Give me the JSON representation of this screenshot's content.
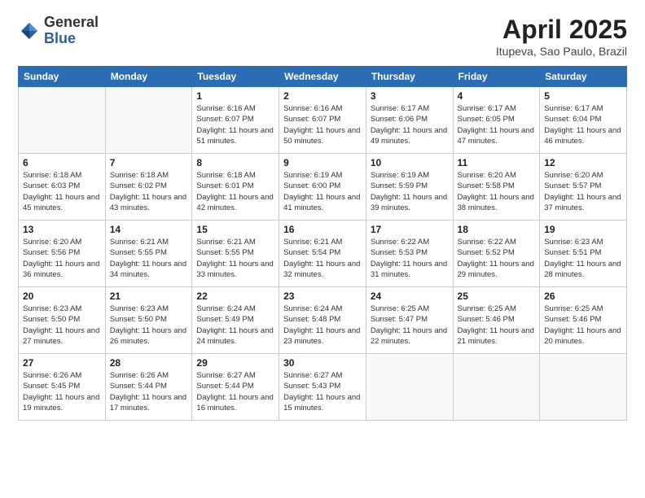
{
  "header": {
    "logo_general": "General",
    "logo_blue": "Blue",
    "title": "April 2025",
    "subtitle": "Itupeva, Sao Paulo, Brazil"
  },
  "days_of_week": [
    "Sunday",
    "Monday",
    "Tuesday",
    "Wednesday",
    "Thursday",
    "Friday",
    "Saturday"
  ],
  "weeks": [
    [
      {
        "day": "",
        "info": ""
      },
      {
        "day": "",
        "info": ""
      },
      {
        "day": "1",
        "info": "Sunrise: 6:16 AM\nSunset: 6:07 PM\nDaylight: 11 hours and 51 minutes."
      },
      {
        "day": "2",
        "info": "Sunrise: 6:16 AM\nSunset: 6:07 PM\nDaylight: 11 hours and 50 minutes."
      },
      {
        "day": "3",
        "info": "Sunrise: 6:17 AM\nSunset: 6:06 PM\nDaylight: 11 hours and 49 minutes."
      },
      {
        "day": "4",
        "info": "Sunrise: 6:17 AM\nSunset: 6:05 PM\nDaylight: 11 hours and 47 minutes."
      },
      {
        "day": "5",
        "info": "Sunrise: 6:17 AM\nSunset: 6:04 PM\nDaylight: 11 hours and 46 minutes."
      }
    ],
    [
      {
        "day": "6",
        "info": "Sunrise: 6:18 AM\nSunset: 6:03 PM\nDaylight: 11 hours and 45 minutes."
      },
      {
        "day": "7",
        "info": "Sunrise: 6:18 AM\nSunset: 6:02 PM\nDaylight: 11 hours and 43 minutes."
      },
      {
        "day": "8",
        "info": "Sunrise: 6:18 AM\nSunset: 6:01 PM\nDaylight: 11 hours and 42 minutes."
      },
      {
        "day": "9",
        "info": "Sunrise: 6:19 AM\nSunset: 6:00 PM\nDaylight: 11 hours and 41 minutes."
      },
      {
        "day": "10",
        "info": "Sunrise: 6:19 AM\nSunset: 5:59 PM\nDaylight: 11 hours and 39 minutes."
      },
      {
        "day": "11",
        "info": "Sunrise: 6:20 AM\nSunset: 5:58 PM\nDaylight: 11 hours and 38 minutes."
      },
      {
        "day": "12",
        "info": "Sunrise: 6:20 AM\nSunset: 5:57 PM\nDaylight: 11 hours and 37 minutes."
      }
    ],
    [
      {
        "day": "13",
        "info": "Sunrise: 6:20 AM\nSunset: 5:56 PM\nDaylight: 11 hours and 36 minutes."
      },
      {
        "day": "14",
        "info": "Sunrise: 6:21 AM\nSunset: 5:55 PM\nDaylight: 11 hours and 34 minutes."
      },
      {
        "day": "15",
        "info": "Sunrise: 6:21 AM\nSunset: 5:55 PM\nDaylight: 11 hours and 33 minutes."
      },
      {
        "day": "16",
        "info": "Sunrise: 6:21 AM\nSunset: 5:54 PM\nDaylight: 11 hours and 32 minutes."
      },
      {
        "day": "17",
        "info": "Sunrise: 6:22 AM\nSunset: 5:53 PM\nDaylight: 11 hours and 31 minutes."
      },
      {
        "day": "18",
        "info": "Sunrise: 6:22 AM\nSunset: 5:52 PM\nDaylight: 11 hours and 29 minutes."
      },
      {
        "day": "19",
        "info": "Sunrise: 6:23 AM\nSunset: 5:51 PM\nDaylight: 11 hours and 28 minutes."
      }
    ],
    [
      {
        "day": "20",
        "info": "Sunrise: 6:23 AM\nSunset: 5:50 PM\nDaylight: 11 hours and 27 minutes."
      },
      {
        "day": "21",
        "info": "Sunrise: 6:23 AM\nSunset: 5:50 PM\nDaylight: 11 hours and 26 minutes."
      },
      {
        "day": "22",
        "info": "Sunrise: 6:24 AM\nSunset: 5:49 PM\nDaylight: 11 hours and 24 minutes."
      },
      {
        "day": "23",
        "info": "Sunrise: 6:24 AM\nSunset: 5:48 PM\nDaylight: 11 hours and 23 minutes."
      },
      {
        "day": "24",
        "info": "Sunrise: 6:25 AM\nSunset: 5:47 PM\nDaylight: 11 hours and 22 minutes."
      },
      {
        "day": "25",
        "info": "Sunrise: 6:25 AM\nSunset: 5:46 PM\nDaylight: 11 hours and 21 minutes."
      },
      {
        "day": "26",
        "info": "Sunrise: 6:25 AM\nSunset: 5:46 PM\nDaylight: 11 hours and 20 minutes."
      }
    ],
    [
      {
        "day": "27",
        "info": "Sunrise: 6:26 AM\nSunset: 5:45 PM\nDaylight: 11 hours and 19 minutes."
      },
      {
        "day": "28",
        "info": "Sunrise: 6:26 AM\nSunset: 5:44 PM\nDaylight: 11 hours and 17 minutes."
      },
      {
        "day": "29",
        "info": "Sunrise: 6:27 AM\nSunset: 5:44 PM\nDaylight: 11 hours and 16 minutes."
      },
      {
        "day": "30",
        "info": "Sunrise: 6:27 AM\nSunset: 5:43 PM\nDaylight: 11 hours and 15 minutes."
      },
      {
        "day": "",
        "info": ""
      },
      {
        "day": "",
        "info": ""
      },
      {
        "day": "",
        "info": ""
      }
    ]
  ]
}
